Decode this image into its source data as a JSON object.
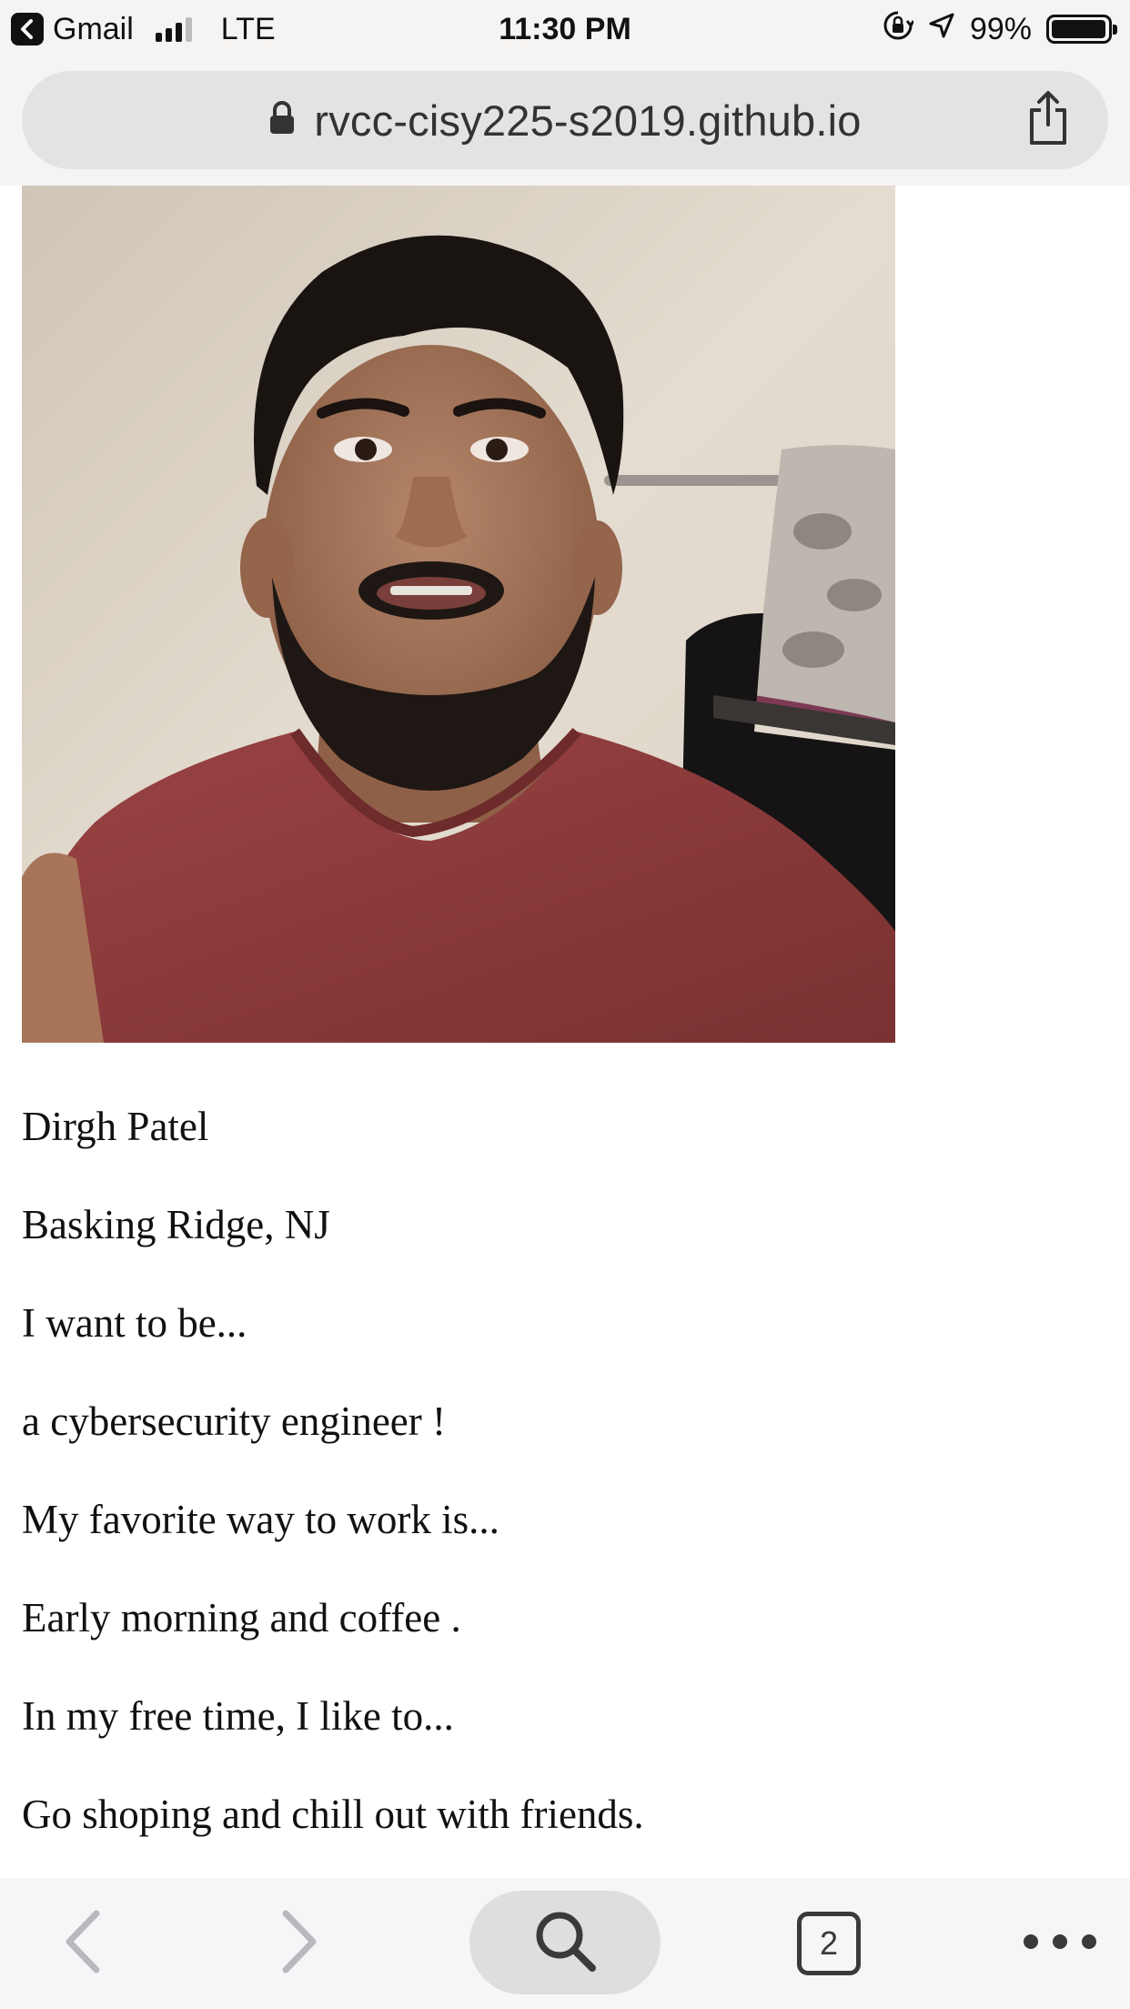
{
  "status_bar": {
    "back_app_label": "Gmail",
    "network": "LTE",
    "time": "11:30 PM",
    "battery_text": "99%",
    "battery_level": 0.99
  },
  "browser": {
    "url": "rvcc-cisy225-s2019.github.io",
    "icons": {
      "lock": "lock-icon",
      "share": "share-icon"
    }
  },
  "profile": {
    "lines": [
      "Dirgh Patel",
      "Basking Ridge, NJ",
      "I want to be...",
      "a cybersecurity engineer !",
      "My favorite way to work is...",
      "Early morning and coffee .",
      "In my free time, I like to...",
      "Go shoping and chill out with friends."
    ]
  },
  "toolbar": {
    "tab_count": "2",
    "icons": [
      "back-chevron-icon",
      "forward-chevron-icon",
      "search-icon",
      "tabs-icon",
      "more-icon"
    ]
  },
  "colors": {
    "chrome_bg": "#f6f4f2",
    "url_bar_bg": "#e4e3e2",
    "toolbar_bg": "#f6f6f8",
    "disabled_icon": "#b9b9bd",
    "shirt": "#8b3a3a"
  }
}
